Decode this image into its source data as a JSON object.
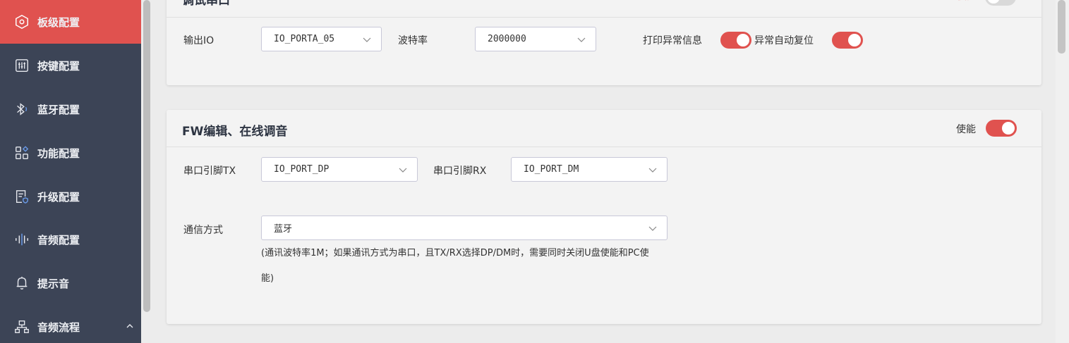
{
  "sidebar": {
    "items": [
      {
        "label": "板级配置",
        "icon": "hexagon-settings-icon",
        "active": true
      },
      {
        "label": "按键配置",
        "icon": "sliders-icon"
      },
      {
        "label": "蓝牙配置",
        "icon": "bluetooth-icon"
      },
      {
        "label": "功能配置",
        "icon": "grid-diamond-icon"
      },
      {
        "label": "升级配置",
        "icon": "document-shield-icon"
      },
      {
        "label": "音频配置",
        "icon": "audio-wave-icon"
      },
      {
        "label": "提示音",
        "icon": "bell-icon"
      },
      {
        "label": "音频流程",
        "icon": "hierarchy-icon"
      }
    ]
  },
  "debug_card": {
    "title": "调试串口",
    "enable_label": "使能",
    "enabled": false,
    "output_io_label": "输出IO",
    "output_io_value": "IO_PORTA_05",
    "baud_label": "波特率",
    "baud_value": "2000000",
    "print_error_label": "打印异常信息",
    "print_error_enabled": true,
    "auto_reset_label": "异常自动复位",
    "auto_reset_enabled": true
  },
  "fw_card": {
    "title": "FW编辑、在线调音",
    "enable_label": "使能",
    "enabled": true,
    "tx_label": "串口引脚TX",
    "tx_value": "IO_PORT_DP",
    "rx_label": "串口引脚RX",
    "rx_value": "IO_PORT_DM",
    "comm_label": "通信方式",
    "comm_value": "蓝牙",
    "note_line1": "(通讯波特率1M；如果通讯方式为串口，且TX/RX选择DP/DM时，需要同时关闭U盘使能和PC使",
    "note_line2": "能)"
  },
  "colors": {
    "accent": "#e0524f",
    "sidebar_bg": "#3c4456",
    "page_bg": "#ececec",
    "card_bg": "#f3f3f3"
  }
}
